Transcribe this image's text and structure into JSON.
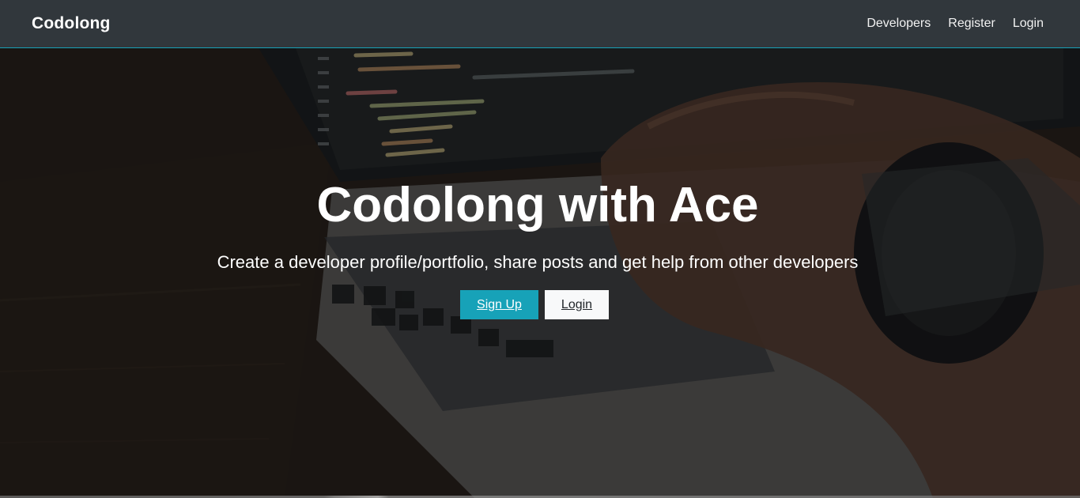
{
  "navbar": {
    "brand": "Codolong",
    "links": [
      {
        "label": "Developers"
      },
      {
        "label": "Register"
      },
      {
        "label": "Login"
      }
    ]
  },
  "hero": {
    "title": "Codolong with Ace",
    "subtitle": "Create a developer profile/portfolio, share posts and get help from other developers",
    "buttons": {
      "signup_label": "Sign Up",
      "login_label": "Login"
    }
  },
  "colors": {
    "accent": "#17a2b8",
    "navbar_bg": "#343a40",
    "light_button": "#f8f9fa"
  }
}
